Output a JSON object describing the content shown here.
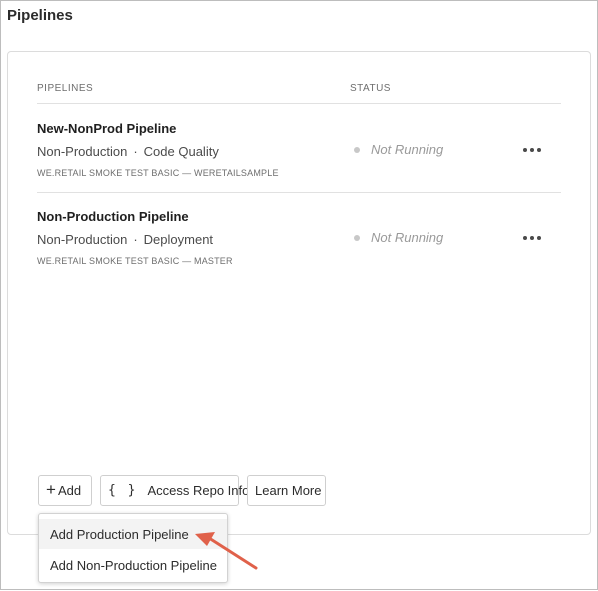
{
  "page_title": "Pipelines",
  "table": {
    "col_pipelines": "PIPELINES",
    "col_status": "STATUS"
  },
  "pipelines": [
    {
      "name": "New-NonProd Pipeline",
      "environment": "Non-Production",
      "type": "Code Quality",
      "meta": "WE.RETAIL SMOKE TEST BASIC — WERETAILSAMPLE",
      "status": "Not Running"
    },
    {
      "name": "Non-Production Pipeline",
      "environment": "Non-Production",
      "type": "Deployment",
      "meta": "WE.RETAIL SMOKE TEST BASIC — MASTER",
      "status": "Not Running"
    }
  ],
  "actions": {
    "add_label": "Add",
    "add_symbol": "+",
    "repo_icon": "{ }",
    "repo_label": "Access Repo Info",
    "learn_label": "Learn More"
  },
  "dropdown": {
    "items": [
      "Add Production Pipeline",
      "Add Non-Production Pipeline"
    ]
  },
  "colors": {
    "annotation_arrow": "#e0614a",
    "status_dot": "#c8c8c8"
  }
}
